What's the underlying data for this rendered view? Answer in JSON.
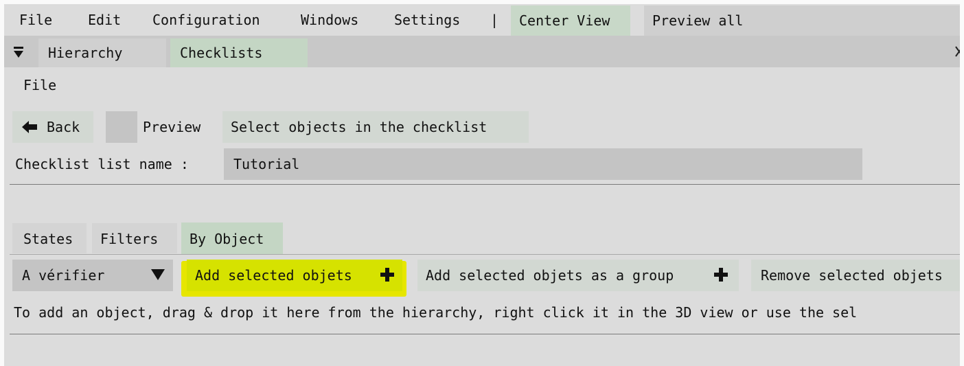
{
  "menubar": {
    "items": [
      "File",
      "Edit",
      "Configuration",
      "Windows",
      "Settings"
    ],
    "separator": "|",
    "center_view": "Center View",
    "preview_all": "Preview all"
  },
  "tabbar": {
    "tabs": [
      "Hierarchy",
      "Checklists"
    ],
    "active_tab": "Checklists"
  },
  "panel": {
    "file_menu": "File",
    "back_label": "Back",
    "preview_label": "Preview",
    "select_objects_label": "Select objects in the checklist",
    "name_label": "Checklist list name :",
    "name_value": "Tutorial"
  },
  "subtabs": {
    "tabs": [
      "States",
      "Filters",
      "By Object"
    ],
    "active_tab": "By Object"
  },
  "object_toolbar": {
    "state_select_value": "A vérifier",
    "add_selected": "Add selected objets",
    "add_group": "Add selected objets as a group",
    "remove_selected": "Remove selected objets"
  },
  "help_text": "To add an object, drag & drop it here from the hierarchy, right click it in the 3D view or use the sel",
  "colors": {
    "window_bg": "#dcdcdc",
    "tabbar_bg": "#c8c8c8",
    "active_tab": "#c4d6c4",
    "button_bg": "#d2d8d2",
    "input_bg": "#c4c4c4",
    "highlight": "#e6e600"
  },
  "icons": {
    "collapse": "triangle-down-icon",
    "back": "arrow-left-icon",
    "dropdown": "triangle-down-icon",
    "add": "plus-icon",
    "close": "close-icon"
  }
}
